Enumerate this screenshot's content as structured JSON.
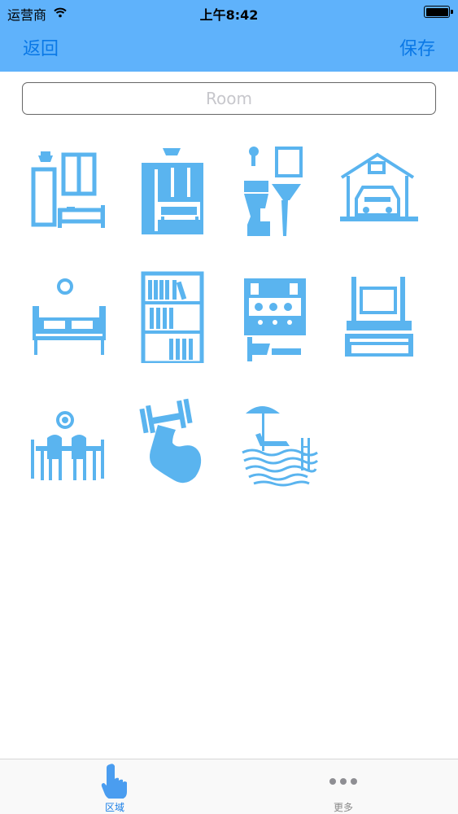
{
  "status_bar": {
    "carrier": "运营商",
    "time": "上午8:42"
  },
  "nav": {
    "back_label": "返回",
    "save_label": "保存"
  },
  "room_input": {
    "placeholder": "Room",
    "value": ""
  },
  "room_icons": [
    {
      "name": "bedroom-wardrobe-icon"
    },
    {
      "name": "bedroom-closet-icon"
    },
    {
      "name": "bathroom-icon"
    },
    {
      "name": "garage-icon"
    },
    {
      "name": "master-bedroom-icon"
    },
    {
      "name": "study-bookshelf-icon"
    },
    {
      "name": "kitchen-icon"
    },
    {
      "name": "living-room-icon"
    },
    {
      "name": "dining-room-icon"
    },
    {
      "name": "gym-icon"
    },
    {
      "name": "pool-icon"
    }
  ],
  "tabs": {
    "area_label": "区域",
    "more_label": "更多"
  },
  "colors": {
    "nav_bar": "#5fb2fb",
    "nav_text": "#0a78e6",
    "icon_blue": "#5ab4ef",
    "tab_active": "#1a7fe6"
  }
}
